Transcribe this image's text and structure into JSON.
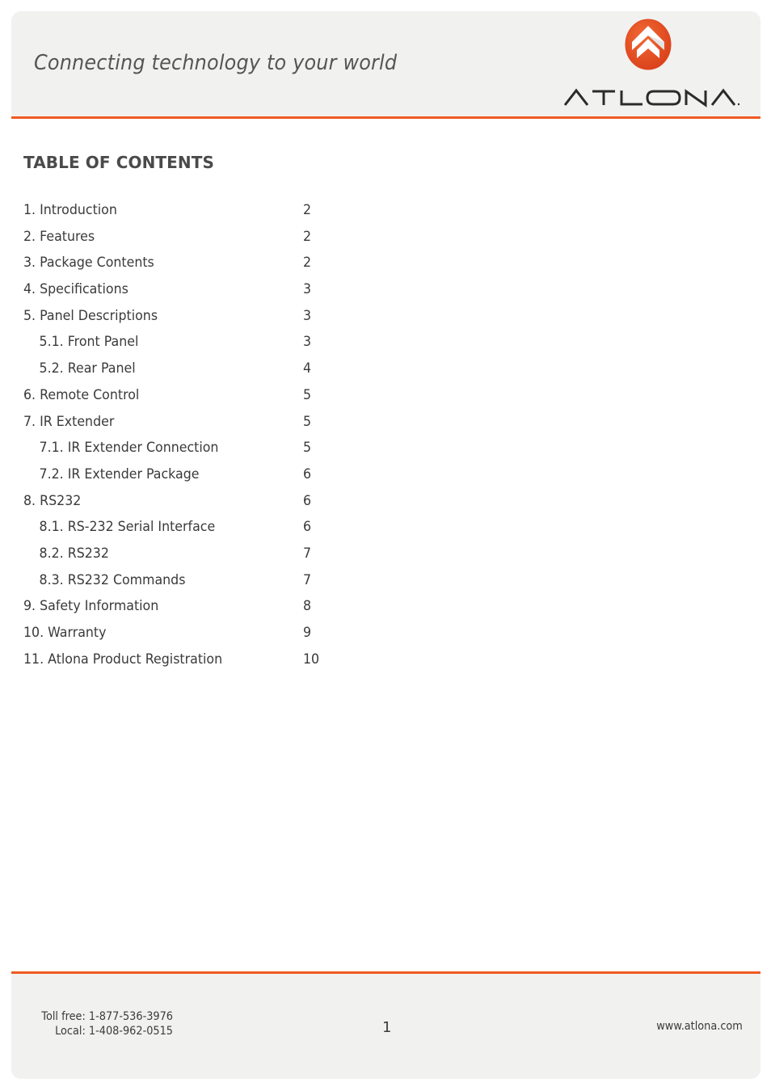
{
  "header": {
    "tagline": "Connecting technology to your world",
    "brand_name": "ATLONA",
    "logo_icon": "atlona-chevron-logo-icon"
  },
  "colors": {
    "accent": "#f05a22",
    "panel_background": "#f1f1f0",
    "text": "#3a3a3a"
  },
  "toc": {
    "title": "TABLE OF CONTENTS",
    "items": [
      {
        "label": "1. Introduction",
        "page": "2",
        "level": 1
      },
      {
        "label": "2. Features",
        "page": "2",
        "level": 1
      },
      {
        "label": "3. Package Contents",
        "page": "2",
        "level": 1
      },
      {
        "label": "4. Specifications",
        "page": "3",
        "level": 1
      },
      {
        "label": "5. Panel Descriptions",
        "page": "3",
        "level": 1
      },
      {
        "label": "5.1. Front Panel",
        "page": "3",
        "level": 2
      },
      {
        "label": "5.2. Rear Panel",
        "page": "4",
        "level": 2
      },
      {
        "label": "6. Remote Control",
        "page": "5",
        "level": 1
      },
      {
        "label": "7. IR Extender",
        "page": "5",
        "level": 1
      },
      {
        "label": "7.1. IR Extender Connection",
        "page": "5",
        "level": 2
      },
      {
        "label": "7.2. IR Extender Package",
        "page": "6",
        "level": 2
      },
      {
        "label": "8. RS232",
        "page": "6",
        "level": 1
      },
      {
        "label": "8.1. RS-232 Serial Interface",
        "page": "6",
        "level": 2
      },
      {
        "label": "8.2. RS232",
        "page": "7",
        "level": 2
      },
      {
        "label": "8.3. RS232 Commands",
        "page": "7",
        "level": 2
      },
      {
        "label": "9. Safety Information",
        "page": "8",
        "level": 1
      },
      {
        "label": "10. Warranty",
        "page": "9",
        "level": 1
      },
      {
        "label": "11. Atlona Product Registration",
        "page": "10",
        "level": 1
      }
    ]
  },
  "footer": {
    "toll_free": "Toll free: 1-877-536-3976",
    "local": "Local: 1-408-962-0515",
    "page_number": "1",
    "website": "www.atlona.com"
  }
}
